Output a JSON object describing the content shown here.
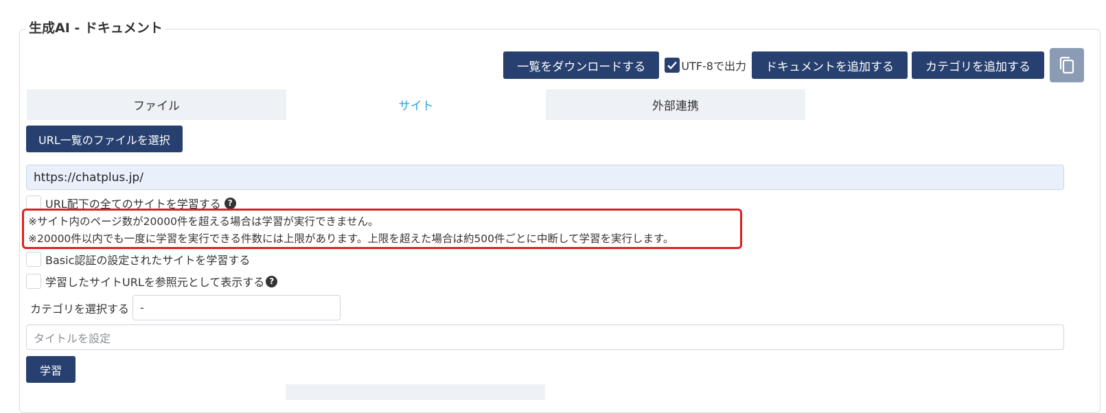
{
  "panel": {
    "title": "生成AI - ドキュメント"
  },
  "toolbar": {
    "download_label": "一覧をダウンロードする",
    "utf8_label": "UTF-8で出力",
    "utf8_checked": true,
    "add_document_label": "ドキュメントを追加する",
    "add_category_label": "カテゴリを追加する",
    "copy_icon": "copy-icon"
  },
  "tabs": [
    {
      "label": "ファイル",
      "active": false
    },
    {
      "label": "サイト",
      "active": true
    },
    {
      "label": "外部連携",
      "active": false
    }
  ],
  "site": {
    "select_file_label": "URL一覧のファイルを選択",
    "url_value": "https://chatplus.jp/",
    "learn_all_label": "URL配下の全てのサイトを学習する",
    "notice_line1": "※サイト内のページ数が20000件を超える場合は学習が実行できません。",
    "notice_line2": "※20000件以内でも一度に学習を実行できる件数には上限があります。上限を超えた場合は約500件ごとに中断して学習を実行します。",
    "basic_auth_label": "Basic認証の設定されたサイトを学習する",
    "show_source_label": "学習したサイトURLを参照元として表示する",
    "category_label": "カテゴリを選択する",
    "category_value": "-",
    "title_placeholder": "タイトルを設定",
    "learn_button": "学習"
  },
  "colors": {
    "navy": "#27406f",
    "active_tab_text": "#29a3d4",
    "notice_border": "#e11d1d"
  }
}
